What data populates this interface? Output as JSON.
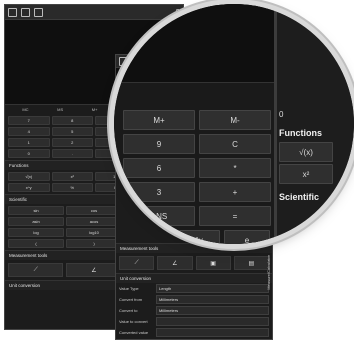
{
  "back_panel": {
    "memory_keys": [
      "MC",
      "MS",
      "M+",
      "M-",
      "MR"
    ],
    "number_keys": [
      "7",
      "8",
      "9",
      "C",
      "4",
      "5",
      "6",
      "/",
      "1",
      "2",
      "3",
      "*",
      "0",
      ".",
      "ANS",
      "-"
    ],
    "functions_title": "Functions",
    "function_keys": [
      "√(x)",
      "x²",
      "1/x",
      "n!",
      "x^y",
      "%",
      "ln",
      "log",
      "e^x",
      "10^x",
      "|x|",
      "round"
    ],
    "scientific_title": "Scientific",
    "scientific_keys": [
      "sin",
      "cos",
      "tan",
      "asin",
      "acos",
      "atan",
      "log",
      "log10",
      "mod",
      "(",
      ")",
      "π"
    ],
    "measurement_title": "Measurement tools",
    "unit_conversion_title": "Unit conversion"
  },
  "front_panel": {
    "measurement_title": "Measurement tools",
    "unit_conversion_title": "Unit conversion",
    "fields": [
      {
        "label": "Value Type",
        "value": "Length"
      },
      {
        "label": "Convert from",
        "value": "Millimeters"
      },
      {
        "label": "Convert to",
        "value": "Millimeters"
      },
      {
        "label": "Value to convert",
        "value": ""
      },
      {
        "label": "Converted value",
        "value": ""
      }
    ],
    "side_tab_label": "Measure/Calculator"
  },
  "magnifier": {
    "keys": [
      "M+",
      "M-",
      "9",
      "C",
      "6",
      "*",
      "3",
      "+",
      "ANS",
      "="
    ],
    "bottom_keys": [
      "x^y",
      "e"
    ],
    "right_value": "0",
    "functions_title": "Functions",
    "function_keys": [
      "√(x)",
      "x²"
    ],
    "scientific_title": "Scientific"
  }
}
